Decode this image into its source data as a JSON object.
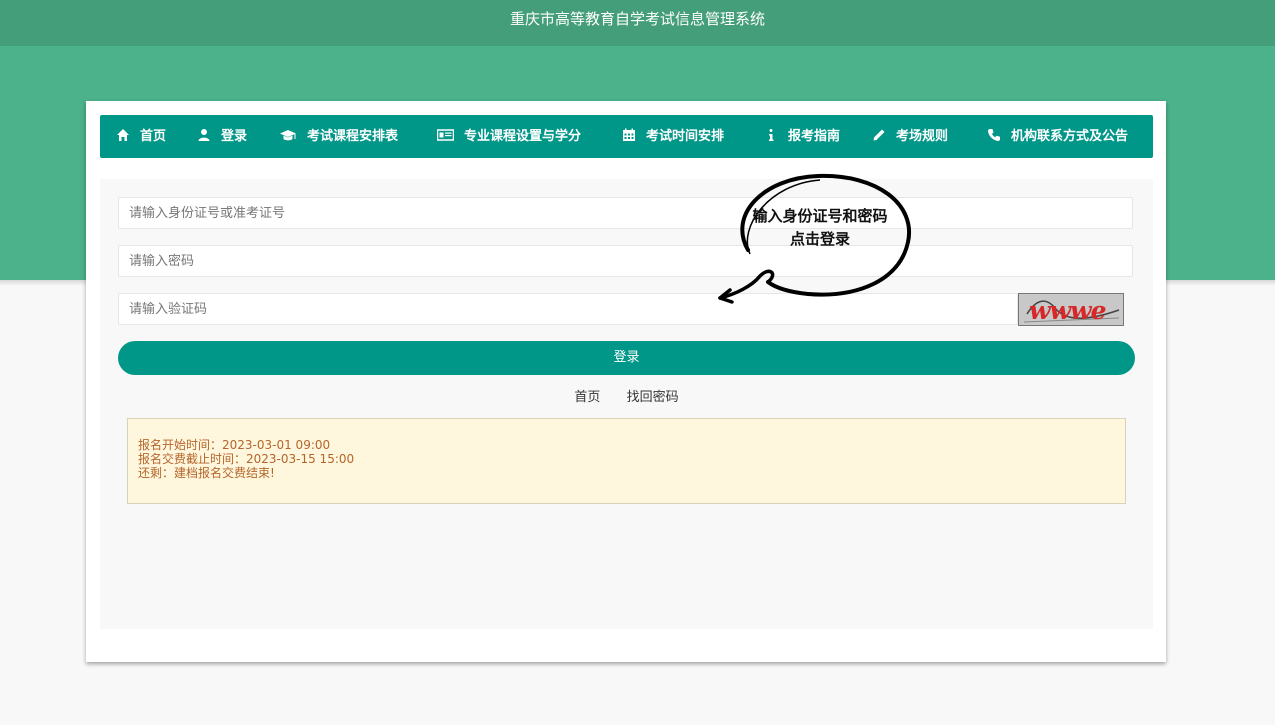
{
  "header": {
    "title": "重庆市高等教育自学考试信息管理系统"
  },
  "nav": {
    "items": [
      {
        "label": "首页",
        "icon": "home-icon"
      },
      {
        "label": "登录",
        "icon": "user-icon"
      },
      {
        "label": "考试课程安排表",
        "icon": "graduation-cap-icon"
      },
      {
        "label": "专业课程设置与学分",
        "icon": "id-card-icon"
      },
      {
        "label": "考试时间安排",
        "icon": "calendar-icon"
      },
      {
        "label": "报考指南",
        "icon": "info-icon"
      },
      {
        "label": "考场规则",
        "icon": "pencil-icon"
      },
      {
        "label": "机构联系方式及公告",
        "icon": "phone-icon"
      }
    ]
  },
  "form": {
    "id_placeholder": "请输入身份证号或准考证号",
    "password_placeholder": "请输入密码",
    "captcha_placeholder": "请输入验证码",
    "captcha_text": "wwwe",
    "login_label": "登录"
  },
  "links": {
    "home": "首页",
    "recover": "找回密码"
  },
  "notice": {
    "lines": [
      "报名开始时间：2023-03-01 09:00",
      "报名交费截止时间：2023-03-15 15:00",
      "还剩：建档报名交费结束!"
    ]
  },
  "annotation": {
    "line1": "输入身份证号和密码",
    "line2": "点击登录"
  },
  "colors": {
    "nav": "#009688",
    "band": "#4cb28b",
    "title_bar": "#449e7a",
    "notice_text": "#b5652a"
  }
}
